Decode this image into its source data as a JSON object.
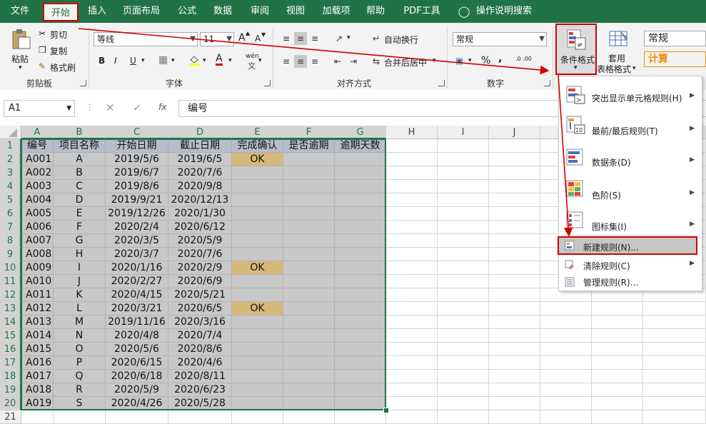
{
  "tabs": [
    "文件",
    "开始",
    "插入",
    "页面布局",
    "公式",
    "数据",
    "审阅",
    "视图",
    "加载项",
    "帮助",
    "PDF工具",
    "操作说明搜索"
  ],
  "ribbon": {
    "clipboard": {
      "paste": "粘贴",
      "cut": "剪切",
      "copy": "复制",
      "format_painter": "格式刷",
      "label": "剪贴板"
    },
    "font": {
      "name": "等线",
      "size": "11",
      "label": "字体",
      "bold": "B",
      "italic": "I",
      "underline": "U",
      "grow": "A",
      "shrink": "A",
      "color_a": "A",
      "phonetic": "wén"
    },
    "alignment": {
      "wrap": "自动换行",
      "merge": "合并后居中",
      "label": "对齐方式"
    },
    "number": {
      "format": "常规",
      "percent": "%",
      "comma": ",",
      "inc_dec": ".0 .00",
      "label": "数字"
    },
    "styles": {
      "conditional": "条件格式",
      "table_line1": "套用",
      "table_line2": "表格格式",
      "style_normal": "常规",
      "style_calc": "计算"
    }
  },
  "formula_bar": {
    "name_box": "A1",
    "fx": "fx",
    "content": "编号"
  },
  "columns": [
    "A",
    "B",
    "C",
    "D",
    "E",
    "F",
    "G",
    "H",
    "I",
    "J"
  ],
  "headers": [
    "编号",
    "项目名称",
    "开始日期",
    "截止日期",
    "完成确认",
    "是否逾期",
    "逾期天数"
  ],
  "rows": [
    [
      "A001",
      "A",
      "2019/5/6",
      "2019/6/5",
      "OK"
    ],
    [
      "A002",
      "B",
      "2019/6/7",
      "2020/7/6",
      ""
    ],
    [
      "A003",
      "C",
      "2019/8/6",
      "2020/9/8",
      ""
    ],
    [
      "A004",
      "D",
      "2019/9/21",
      "2020/12/13",
      ""
    ],
    [
      "A005",
      "E",
      "2019/12/26",
      "2020/1/30",
      ""
    ],
    [
      "A006",
      "F",
      "2020/2/4",
      "2020/6/12",
      ""
    ],
    [
      "A007",
      "G",
      "2020/3/5",
      "2020/5/9",
      ""
    ],
    [
      "A008",
      "H",
      "2020/3/7",
      "2020/7/6",
      ""
    ],
    [
      "A009",
      "I",
      "2020/1/16",
      "2020/2/9",
      "OK"
    ],
    [
      "A010",
      "J",
      "2020/2/27",
      "2020/6/9",
      ""
    ],
    [
      "A011",
      "K",
      "2020/4/15",
      "2020/5/21",
      ""
    ],
    [
      "A012",
      "L",
      "2020/3/21",
      "2020/6/5",
      "OK"
    ],
    [
      "A013",
      "M",
      "2019/11/16",
      "2020/3/16",
      ""
    ],
    [
      "A014",
      "N",
      "2020/4/8",
      "2020/7/4",
      ""
    ],
    [
      "A015",
      "O",
      "2020/5/6",
      "2020/8/6",
      ""
    ],
    [
      "A016",
      "P",
      "2020/6/15",
      "2020/4/6",
      ""
    ],
    [
      "A017",
      "Q",
      "2020/6/18",
      "2020/8/11",
      ""
    ],
    [
      "A018",
      "R",
      "2020/5/9",
      "2020/6/23",
      ""
    ],
    [
      "A019",
      "S",
      "2020/4/26",
      "2020/5/28",
      ""
    ]
  ],
  "row_numbers": [
    "1",
    "2",
    "3",
    "4",
    "5",
    "6",
    "7",
    "8",
    "9",
    "10",
    "11",
    "12",
    "13",
    "14",
    "15",
    "16",
    "17",
    "18",
    "19",
    "20",
    "21"
  ],
  "menu": {
    "items": [
      "突出显示单元格规则(H)",
      "最前/最后规则(T)",
      "数据条(D)",
      "色阶(S)",
      "图标集(I)"
    ],
    "sub_items": [
      "新建规则(N)...",
      "清除规则(C)",
      "管理规则(R)..."
    ]
  },
  "colors": {
    "accent": "#217346",
    "highlight_red": "#d00000",
    "ok_fill": "#d6b878",
    "header_fill": "#b8bccc"
  }
}
